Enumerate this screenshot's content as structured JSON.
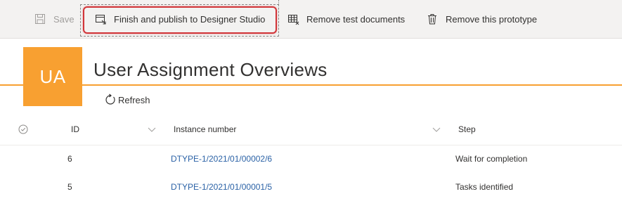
{
  "toolbar": {
    "save_label": "Save",
    "finish_label": "Finish and publish to Designer Studio",
    "remove_test_label": "Remove test documents",
    "remove_proto_label": "Remove this prototype"
  },
  "header": {
    "avatar_initials": "UA",
    "title": "User Assignment Overviews",
    "accent_color": "#f8a031"
  },
  "commands": {
    "refresh_label": "Refresh"
  },
  "table": {
    "columns": [
      {
        "label": "ID"
      },
      {
        "label": "Instance number"
      },
      {
        "label": "Step"
      }
    ],
    "rows": [
      {
        "id": "6",
        "instance": "DTYPE-1/2021/01/00002/6",
        "step": "Wait for completion"
      },
      {
        "id": "5",
        "instance": "DTYPE-1/2021/01/00001/5",
        "step": "Tasks identified"
      }
    ],
    "link_color": "#2b62a6"
  }
}
